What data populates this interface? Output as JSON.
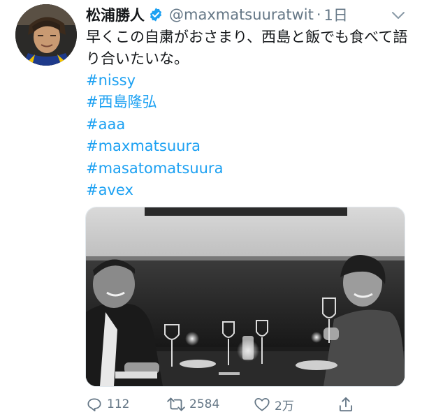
{
  "tweet": {
    "author_name": "松浦勝人",
    "handle": "@maxmatsuuratwit",
    "separator": "·",
    "time": "1日",
    "text": "早くこの自粛がおさまり、西島と飯でも食べて語り合いたいな。",
    "hashtags": [
      "#nissy",
      "#西島隆弘",
      "#aaa",
      "#maxmatsuura",
      "#masatomatsuura",
      "#avex"
    ],
    "reply_count": "112",
    "retweet_count": "2584",
    "like_count": "2万"
  },
  "icons": {
    "verified": "verified-badge-icon",
    "caret": "chevron-down-icon",
    "reply": "reply-icon",
    "retweet": "retweet-icon",
    "like": "heart-icon",
    "share": "share-icon"
  },
  "colors": {
    "text": "#14171a",
    "secondary": "#657786",
    "link": "#1da1f2",
    "verified": "#1da1f2"
  }
}
